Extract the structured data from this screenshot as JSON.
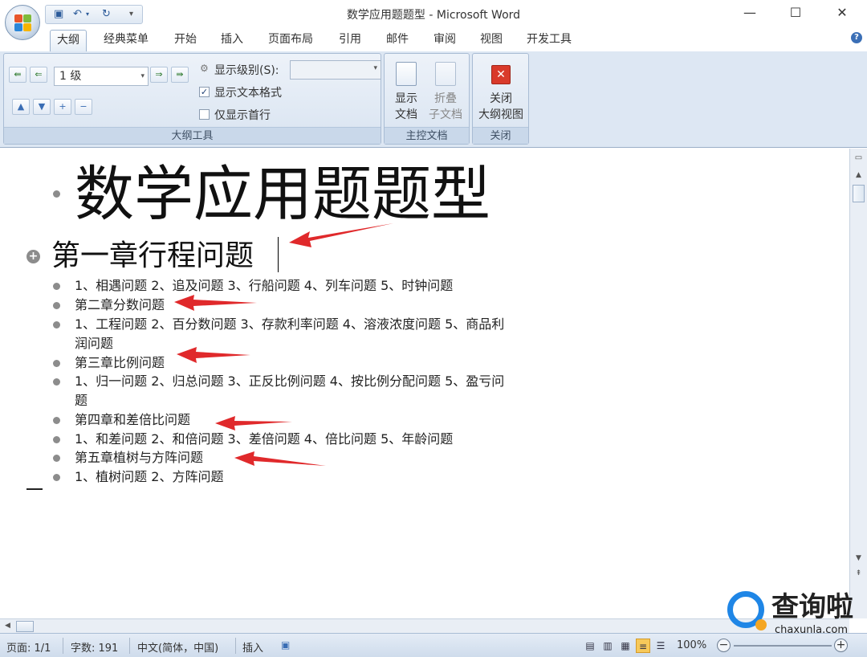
{
  "window": {
    "title": "数学应用题题型 - Microsoft Word",
    "minimize": "—",
    "maximize": "☐",
    "close": "✕"
  },
  "qat": {
    "save_icon": "save-icon",
    "undo_icon": "undo-icon",
    "redo_icon": "redo-icon",
    "customize_icon": "customize-icon"
  },
  "tabs": [
    "大纲",
    "经典菜单",
    "开始",
    "插入",
    "页面布局",
    "引用",
    "邮件",
    "审阅",
    "视图",
    "开发工具"
  ],
  "ribbon": {
    "outline_tools": {
      "label": "大纲工具",
      "level_value": "1 级",
      "show_level_label": "显示级别(S):",
      "show_text_format_label": "显示文本格式",
      "show_text_format_checked": true,
      "show_first_line_label": "仅显示首行",
      "show_first_line_checked": false
    },
    "master_doc": {
      "label": "主控文档",
      "show_doc_line1": "显示",
      "show_doc_line2": "文档",
      "collapse_line1": "折叠",
      "collapse_line2": "子文档"
    },
    "close": {
      "label": "关闭",
      "close_outline_line1": "关闭",
      "close_outline_line2": "大纲视图"
    }
  },
  "document": {
    "title": "数学应用题题型",
    "chapter1": "第一章行程问题",
    "items": [
      "1、相遇问题 2、追及问题 3、行船问题 4、列车问题 5、时钟问题",
      "第二章分数问题",
      "1、工程问题 2、百分数问题 3、存款利率问题 4、溶液浓度问题 5、商品利",
      "润问题",
      "第三章比例问题",
      "1、归一问题 2、归总问题 3、正反比例问题 4、按比例分配问题 5、盈亏问",
      "题",
      "第四章和差倍比问题",
      "1、和差问题 2、和倍问题 3、差倍问题 4、倍比问题 5、年龄问题",
      "第五章植树与方阵问题",
      "1、植树问题 2、方阵问题"
    ]
  },
  "statusbar": {
    "page": "页面: 1/1",
    "words": "字数: 191",
    "language": "中文(简体，中国)",
    "mode": "插入",
    "zoom": "100%"
  },
  "watermark": {
    "text": "查询啦",
    "url": "chaxunla.com"
  },
  "colors": {
    "arrow": "#e0292b",
    "ribbon_bg": "#dde7f3",
    "accent": "#2c5b9a"
  }
}
